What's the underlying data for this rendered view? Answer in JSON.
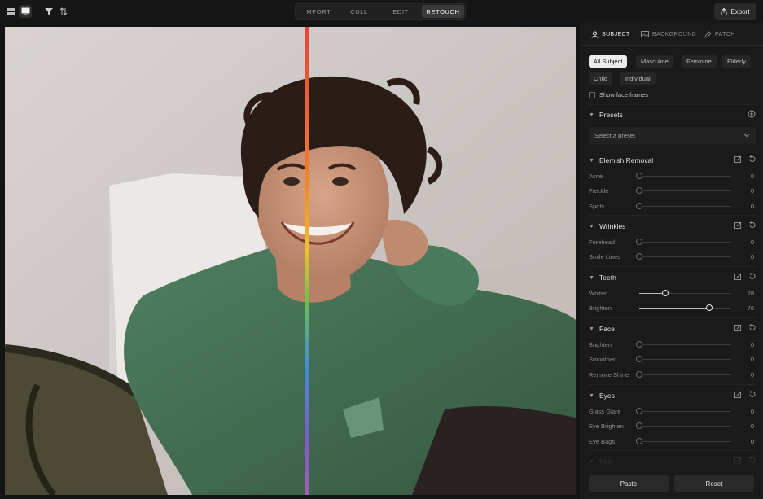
{
  "toolbar": {
    "grid_view_icon": "grid-icon",
    "single_view_icon": "monitor-icon",
    "filter_icon": "filter-icon",
    "sort_icon": "sort-icon"
  },
  "modes": [
    {
      "label": "IMPORT",
      "active": false
    },
    {
      "label": "CULL",
      "active": false
    },
    {
      "label": "EDIT",
      "active": false
    },
    {
      "label": "RETOUCH",
      "active": true
    }
  ],
  "export_label": "Export",
  "panel": {
    "tabs": [
      {
        "label": "SUBJECT",
        "icon": "person-icon",
        "active": true
      },
      {
        "label": "BACKGROUND",
        "icon": "image-icon",
        "active": false
      },
      {
        "label": "PATCH",
        "icon": "patch-icon",
        "active": false
      }
    ],
    "subject_filters": [
      "All Subject",
      "Masculine",
      "Feminine",
      "Elderly",
      "Child",
      "Individual"
    ],
    "active_filter": "All Subject",
    "show_face_frames": {
      "label": "Show face frames",
      "checked": false
    },
    "presets": {
      "title": "Presets",
      "placeholder": "Select a preset"
    },
    "sections": [
      {
        "title": "Blemish Removal",
        "sliders": [
          {
            "label": "Acne",
            "value": 0
          },
          {
            "label": "Freckle",
            "value": 0
          },
          {
            "label": "Spots",
            "value": 0
          }
        ]
      },
      {
        "title": "Wrinkles",
        "sliders": [
          {
            "label": "Forehead",
            "value": 0
          },
          {
            "label": "Smile Lines",
            "value": 0
          }
        ]
      },
      {
        "title": "Teeth",
        "sliders": [
          {
            "label": "Whiten",
            "value": 28
          },
          {
            "label": "Brighten",
            "value": 76
          }
        ]
      },
      {
        "title": "Face",
        "sliders": [
          {
            "label": "Brighten",
            "value": 0
          },
          {
            "label": "Smoothen",
            "value": 0
          },
          {
            "label": "Remove Shine",
            "value": 0
          }
        ]
      },
      {
        "title": "Eyes",
        "sliders": [
          {
            "label": "Glass Glare",
            "value": 0
          },
          {
            "label": "Eye Brighten",
            "value": 0
          },
          {
            "label": "Eye Bags",
            "value": 0
          }
        ]
      },
      {
        "title": "Hair",
        "sliders": []
      }
    ],
    "paste_label": "Paste",
    "reset_label": "Reset"
  },
  "colors": {
    "accent_active": "#ececec",
    "background": "#141414",
    "panel": "#1a1a1a"
  }
}
